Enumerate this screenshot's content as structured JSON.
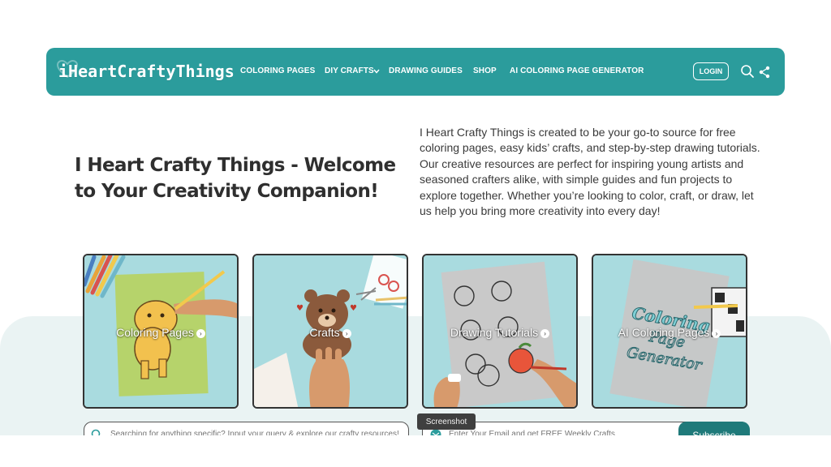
{
  "brand": {
    "logo_text": "iHeartCraftyThings",
    "primary_color": "#2b9c9c"
  },
  "nav": {
    "items": [
      "COLORING PAGES",
      "DIY CRAFTS",
      "DRAWING GUIDES",
      "SHOP",
      "AI COLORING PAGE GENERATOR"
    ],
    "login_label": "LOGIN",
    "icons": [
      "search-icon",
      "share-icon",
      "chevron-down-icon"
    ]
  },
  "intro": {
    "title": "I Heart Crafty Things - Welcome to Your Creativity Companion!",
    "description": "I Heart Crafty Things is created to be your go-to source for free coloring pages, easy kids’ crafts, and step-by-step drawing tutorials. Our creative resources are perfect for inspiring young artists and seasoned crafters alike, with simple guides and fun projects to explore together. Whether you’re looking to color, craft, or draw, let us help you bring more creativity into every day!"
  },
  "cards": [
    {
      "label": "Coloring Pages"
    },
    {
      "label": "Crafts"
    },
    {
      "label": "Drawing Tutorials"
    },
    {
      "label": "AI Coloring Pages"
    }
  ],
  "card_art_text": {
    "line1": "Coloring",
    "line2": "Page",
    "line3": "Generator"
  },
  "search": {
    "placeholder": "Searching for anything specific? Input your query & explore our crafty resources!"
  },
  "newsletter": {
    "placeholder": "Enter Your Email and get FREE Weekly Crafts",
    "button_label": "Subscribe"
  },
  "tooltip": {
    "text": "Screenshot"
  }
}
